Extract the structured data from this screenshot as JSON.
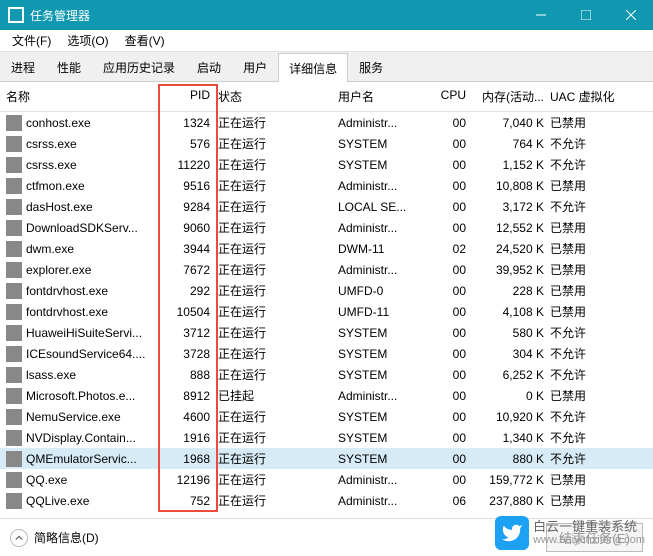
{
  "window": {
    "title": "任务管理器"
  },
  "menu": {
    "file": "文件(F)",
    "options": "选项(O)",
    "view": "查看(V)"
  },
  "tabs": {
    "items": [
      {
        "label": "进程"
      },
      {
        "label": "性能"
      },
      {
        "label": "应用历史记录"
      },
      {
        "label": "启动"
      },
      {
        "label": "用户"
      },
      {
        "label": "详细信息"
      },
      {
        "label": "服务"
      }
    ],
    "active": 5
  },
  "columns": {
    "name": "名称",
    "pid": "PID",
    "status": "状态",
    "user": "用户名",
    "cpu": "CPU",
    "mem": "内存(活动...",
    "uac": "UAC 虚拟化"
  },
  "processes": [
    {
      "icon": "ic-black",
      "name": "conhost.exe",
      "pid": "1324",
      "status": "正在运行",
      "user": "Administr...",
      "cpu": "00",
      "mem": "7,040 K",
      "uac": "已禁用"
    },
    {
      "icon": "ic-gray",
      "name": "csrss.exe",
      "pid": "576",
      "status": "正在运行",
      "user": "SYSTEM",
      "cpu": "00",
      "mem": "764 K",
      "uac": "不允许"
    },
    {
      "icon": "ic-gray",
      "name": "csrss.exe",
      "pid": "11220",
      "status": "正在运行",
      "user": "SYSTEM",
      "cpu": "00",
      "mem": "1,152 K",
      "uac": "不允许"
    },
    {
      "icon": "ic-blue",
      "name": "ctfmon.exe",
      "pid": "9516",
      "status": "正在运行",
      "user": "Administr...",
      "cpu": "00",
      "mem": "10,808 K",
      "uac": "已禁用"
    },
    {
      "icon": "ic-gray",
      "name": "dasHost.exe",
      "pid": "9284",
      "status": "正在运行",
      "user": "LOCAL SE...",
      "cpu": "00",
      "mem": "3,172 K",
      "uac": "不允许"
    },
    {
      "icon": "ic-gray",
      "name": "DownloadSDKServ...",
      "pid": "9060",
      "status": "正在运行",
      "user": "Administr...",
      "cpu": "00",
      "mem": "12,552 K",
      "uac": "已禁用"
    },
    {
      "icon": "ic-cyan",
      "name": "dwm.exe",
      "pid": "3944",
      "status": "正在运行",
      "user": "DWM-11",
      "cpu": "02",
      "mem": "24,520 K",
      "uac": "已禁用"
    },
    {
      "icon": "ic-yellow",
      "name": "explorer.exe",
      "pid": "7672",
      "status": "正在运行",
      "user": "Administr...",
      "cpu": "00",
      "mem": "39,952 K",
      "uac": "已禁用"
    },
    {
      "icon": "ic-gray",
      "name": "fontdrvhost.exe",
      "pid": "292",
      "status": "正在运行",
      "user": "UMFD-0",
      "cpu": "00",
      "mem": "228 K",
      "uac": "已禁用"
    },
    {
      "icon": "ic-gray",
      "name": "fontdrvhost.exe",
      "pid": "10504",
      "status": "正在运行",
      "user": "UMFD-11",
      "cpu": "00",
      "mem": "4,108 K",
      "uac": "已禁用"
    },
    {
      "icon": "ic-gray",
      "name": "HuaweiHiSuiteServi...",
      "pid": "3712",
      "status": "正在运行",
      "user": "SYSTEM",
      "cpu": "00",
      "mem": "580 K",
      "uac": "不允许"
    },
    {
      "icon": "ic-gray",
      "name": "ICEsoundService64....",
      "pid": "3728",
      "status": "正在运行",
      "user": "SYSTEM",
      "cpu": "00",
      "mem": "304 K",
      "uac": "不允许"
    },
    {
      "icon": "ic-gray",
      "name": "lsass.exe",
      "pid": "888",
      "status": "正在运行",
      "user": "SYSTEM",
      "cpu": "00",
      "mem": "6,252 K",
      "uac": "不允许"
    },
    {
      "icon": "ic-blue",
      "name": "Microsoft.Photos.e...",
      "pid": "8912",
      "status": "已挂起",
      "user": "Administr...",
      "cpu": "00",
      "mem": "0 K",
      "uac": "已禁用"
    },
    {
      "icon": "ic-teal",
      "name": "NemuService.exe",
      "pid": "4600",
      "status": "正在运行",
      "user": "SYSTEM",
      "cpu": "00",
      "mem": "10,920 K",
      "uac": "不允许"
    },
    {
      "icon": "ic-green",
      "name": "NVDisplay.Contain...",
      "pid": "1916",
      "status": "正在运行",
      "user": "SYSTEM",
      "cpu": "00",
      "mem": "1,340 K",
      "uac": "不允许"
    },
    {
      "icon": "ic-gray",
      "name": "QMEmulatorServic...",
      "pid": "1968",
      "status": "正在运行",
      "user": "SYSTEM",
      "cpu": "00",
      "mem": "880 K",
      "uac": "不允许",
      "selected": true
    },
    {
      "icon": "ic-red",
      "name": "QQ.exe",
      "pid": "12196",
      "status": "正在运行",
      "user": "Administr...",
      "cpu": "00",
      "mem": "159,772 K",
      "uac": "已禁用"
    },
    {
      "icon": "ic-blue",
      "name": "QQLive.exe",
      "pid": "752",
      "status": "正在运行",
      "user": "Administr...",
      "cpu": "06",
      "mem": "237,880 K",
      "uac": "已禁用"
    }
  ],
  "footer": {
    "less_details": "简略信息(D)",
    "end_task": "结束任务(E)"
  },
  "watermark": {
    "brand": "白云一键重装系统",
    "url": "www.baiyunxitong.com"
  }
}
